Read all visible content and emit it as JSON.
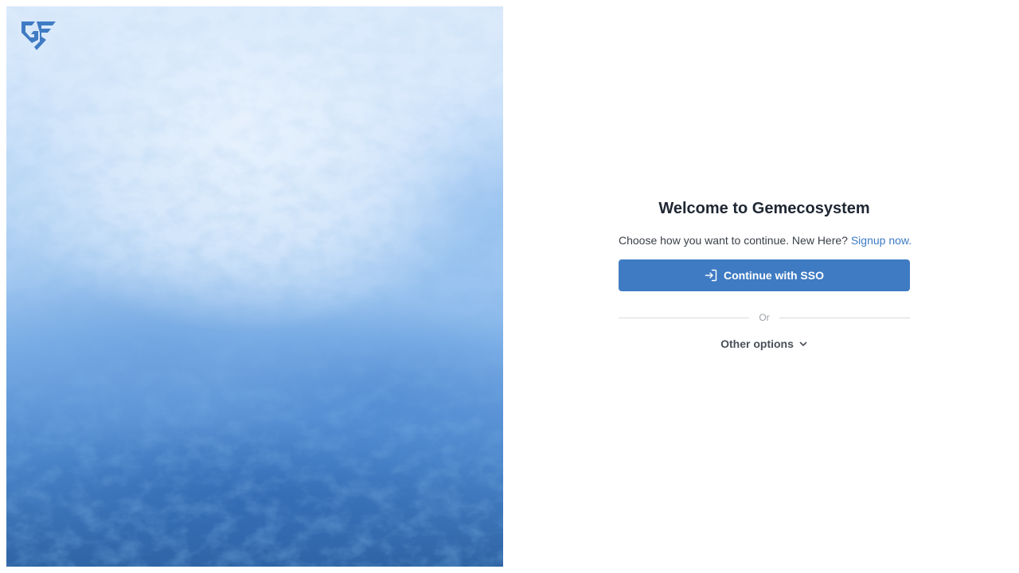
{
  "brand": {
    "logo_text": "GF",
    "logo_color": "#3f7bc3"
  },
  "auth": {
    "title": "Welcome to Gemecosystem",
    "subtitle": "Choose how you want to continue. New Here?",
    "signup_link": "Signup now.",
    "sso_button": "Continue with SSO",
    "sso_icon": "sign-in-icon",
    "divider_text": "Or",
    "other_options": "Other options",
    "other_options_icon": "chevron-down-icon"
  },
  "colors": {
    "primary": "#3f7bc3",
    "link": "#3d7ac4",
    "title": "#1f2733"
  }
}
